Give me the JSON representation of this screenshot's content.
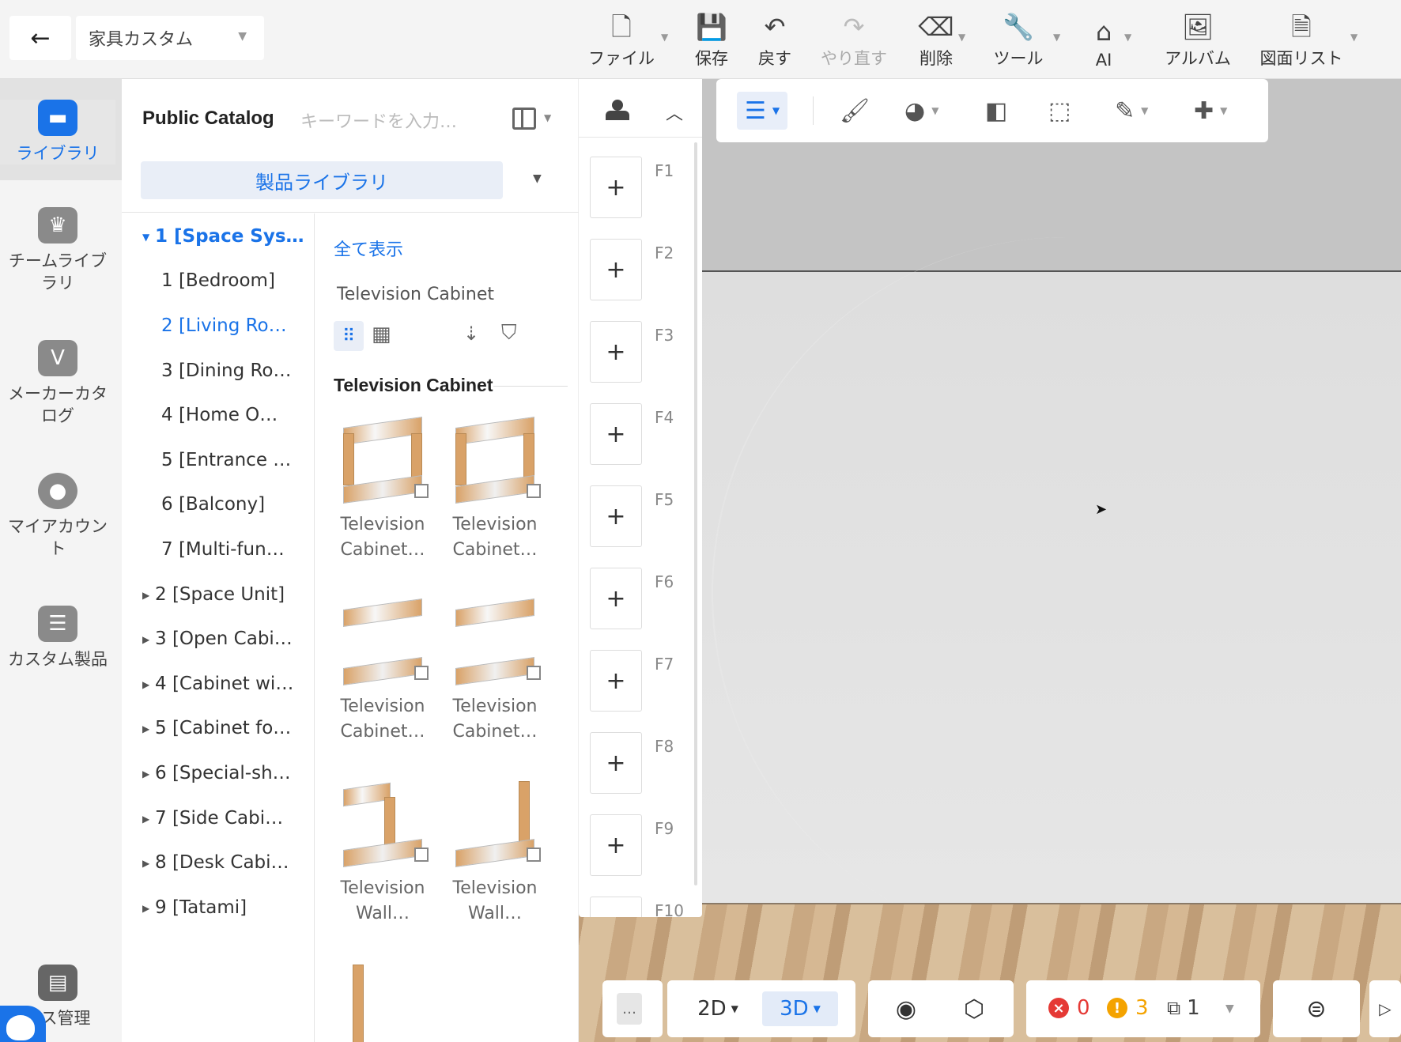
{
  "topbar": {
    "back_label": "←",
    "mode": "家具カスタム",
    "items": [
      {
        "label": "ファイル",
        "icon": "file-icon",
        "glyph": "🗋"
      },
      {
        "label": "保存",
        "icon": "save-icon",
        "glyph": "💾"
      },
      {
        "label": "戻す",
        "icon": "undo-icon",
        "glyph": "↶"
      },
      {
        "label": "やり直す",
        "icon": "redo-icon",
        "glyph": "↷"
      },
      {
        "label": "削除",
        "icon": "eraser-icon",
        "glyph": "⌫"
      },
      {
        "label": "ツール",
        "icon": "wrench-icon",
        "glyph": "🔧"
      },
      {
        "label": "AI",
        "icon": "ai-icon",
        "glyph": "⌂"
      },
      {
        "label": "アルバム",
        "icon": "album-icon",
        "glyph": "🖼"
      },
      {
        "label": "図面リスト",
        "icon": "drawing-list-icon",
        "glyph": "🗎"
      }
    ]
  },
  "rail": {
    "items": [
      {
        "label": "ライブラリ",
        "icon": "library-sofa-icon"
      },
      {
        "label": "チームライブラリ",
        "icon": "team-crown-icon"
      },
      {
        "label": "メーカーカタログ",
        "icon": "maker-badge-icon"
      },
      {
        "label": "マイアカウント",
        "icon": "account-person-icon"
      },
      {
        "label": "カスタム製品",
        "icon": "custom-product-icon"
      },
      {
        "label": "ース管理",
        "icon": "resource-manage-icon"
      }
    ]
  },
  "catalog": {
    "title": "Public Catalog",
    "search_placeholder": "キーワードを入力…",
    "library": "製品ライブラリ",
    "tree": [
      {
        "label": "1 [Space Sys…",
        "level": 0,
        "state": "expanded"
      },
      {
        "label": "1 [Bedroom]",
        "level": 1,
        "state": "leaf"
      },
      {
        "label": "2 [Living Ro…",
        "level": 1,
        "state": "selected"
      },
      {
        "label": "3 [Dining Ro…",
        "level": 1,
        "state": "leaf"
      },
      {
        "label": "4 [Home O…",
        "level": 1,
        "state": "leaf"
      },
      {
        "label": "5 [Entrance …",
        "level": 1,
        "state": "leaf"
      },
      {
        "label": "6 [Balcony]",
        "level": 1,
        "state": "leaf"
      },
      {
        "label": "7 [Multi-fun…",
        "level": 1,
        "state": "leaf"
      },
      {
        "label": "2 [Space Unit]",
        "level": 0,
        "state": "collapsed"
      },
      {
        "label": "3 [Open Cabi…",
        "level": 0,
        "state": "collapsed"
      },
      {
        "label": "4 [Cabinet wi…",
        "level": 0,
        "state": "collapsed"
      },
      {
        "label": "5 [Cabinet fo…",
        "level": 0,
        "state": "collapsed"
      },
      {
        "label": "6 [Special-sh…",
        "level": 0,
        "state": "collapsed"
      },
      {
        "label": "7 [Side Cabi…",
        "level": 0,
        "state": "collapsed"
      },
      {
        "label": "8 [Desk Cabi…",
        "level": 0,
        "state": "collapsed"
      },
      {
        "label": "9 [Tatami]",
        "level": 0,
        "state": "collapsed"
      }
    ],
    "show_all": "全て表示",
    "breadcrumb": "Television Cabinet",
    "section_title": "Television Cabinet",
    "products": [
      {
        "line1": "Television",
        "line2": "Cabinet…"
      },
      {
        "line1": "Television",
        "line2": "Cabinet…"
      },
      {
        "line1": "Television",
        "line2": "Cabinet…"
      },
      {
        "line1": "Television",
        "line2": "Cabinet…"
      },
      {
        "line1": "Television",
        "line2": "Wall…"
      },
      {
        "line1": "Television",
        "line2": "Wall…"
      }
    ]
  },
  "floors": [
    "F1",
    "F2",
    "F3",
    "F4",
    "F5",
    "F6",
    "F7",
    "F8",
    "F9",
    "F10"
  ],
  "bottombar": {
    "more": "…",
    "view_2d": "2D",
    "view_3d": "3D",
    "errors": "0",
    "warnings": "3",
    "rooms": "1"
  },
  "colors": {
    "accent": "#1a73e8",
    "error": "#e53935",
    "warning": "#f4a300",
    "wood": "#d9a268"
  }
}
